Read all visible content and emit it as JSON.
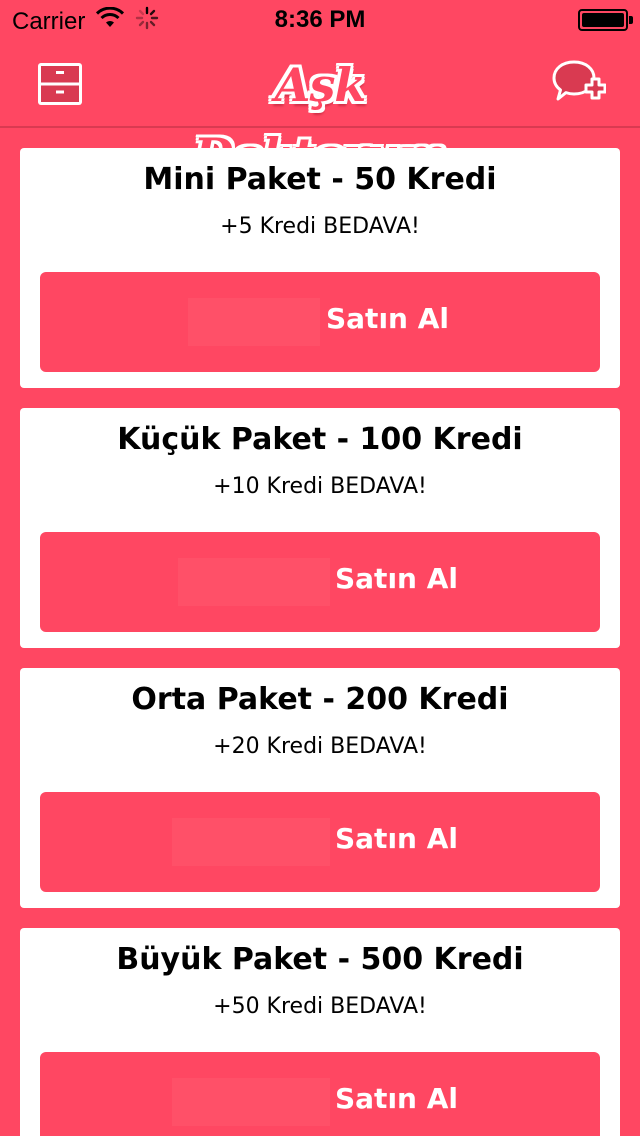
{
  "status_bar": {
    "carrier": "Carrier",
    "time": "8:36 PM"
  },
  "nav": {
    "title": "Aşk Doktorum"
  },
  "colors": {
    "accent": "#FF4762",
    "card": "#FFFFFF"
  },
  "packages": [
    {
      "title": "Mini Paket - 50 Kredi",
      "bonus": "+5 Kredi BEDAVA!",
      "button_label": "Satın Al"
    },
    {
      "title": "Küçük Paket - 100 Kredi",
      "bonus": "+10 Kredi BEDAVA!",
      "button_label": "Satın Al"
    },
    {
      "title": "Orta Paket - 200 Kredi",
      "bonus": "+20 Kredi BEDAVA!",
      "button_label": "Satın Al"
    },
    {
      "title": "Büyük Paket - 500 Kredi",
      "bonus": "+50 Kredi BEDAVA!",
      "button_label": "Satın Al"
    }
  ]
}
